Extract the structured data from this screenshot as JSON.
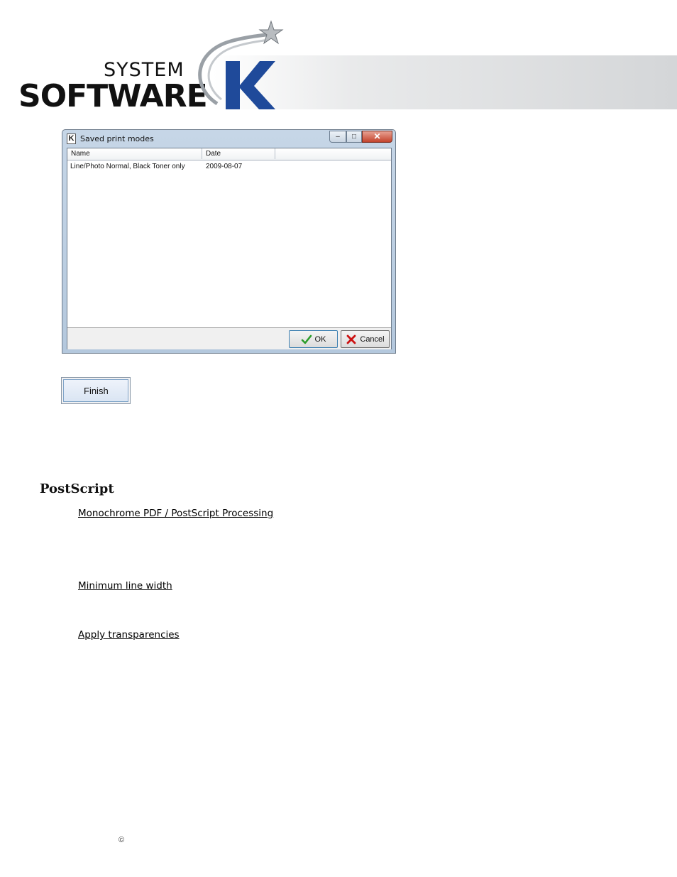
{
  "logo": {
    "line1": "SYSTEM",
    "line2": "SOFTWARE",
    "letter": "K"
  },
  "dialog": {
    "title": "Saved print modes",
    "columns": [
      "Name",
      "Date"
    ],
    "rows": [
      {
        "name": "Line/Photo Normal, Black Toner only",
        "date": "2009-08-07"
      }
    ],
    "ok_label": "OK",
    "cancel_label": "Cancel"
  },
  "finish_label": "Finish",
  "section": {
    "title": "PostScript",
    "items": [
      "Monochrome PDF / PostScript Processing",
      "Minimum line width",
      "Apply transparencies"
    ]
  },
  "footer": {
    "copyright_symbol": "©"
  },
  "colors": {
    "logo_blue": "#1f4a9a",
    "dialog_frame": "#b4c8dd",
    "ok_check": "#2a9d2a",
    "cancel_x": "#cc1111"
  }
}
